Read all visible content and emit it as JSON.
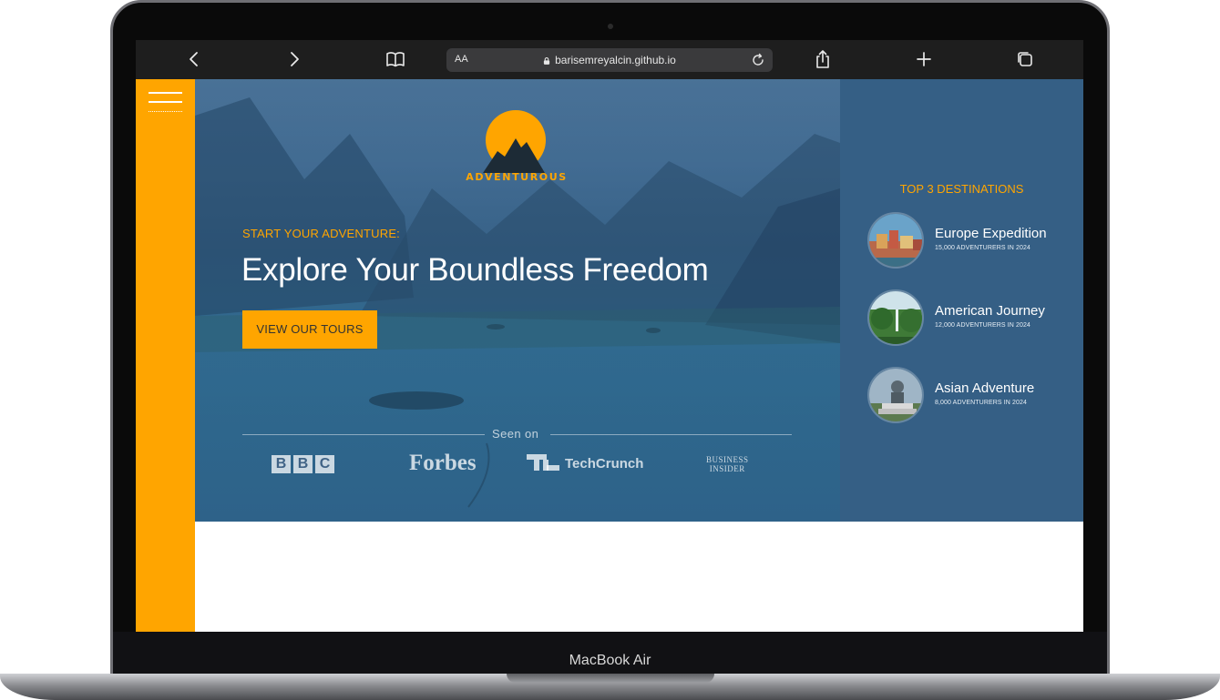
{
  "device": {
    "model_label": "MacBook Air"
  },
  "browser": {
    "address": {
      "text_size_label": "AA",
      "url": "barisemreyalcin.github.io"
    },
    "icons": [
      "back-icon",
      "forward-icon",
      "bookmarks-icon",
      "lock-icon",
      "reload-icon",
      "share-icon",
      "new-tab-icon",
      "tabs-icon"
    ]
  },
  "site": {
    "brand": "ADVENTUROUS",
    "hero": {
      "kicker": "START YOUR ADVENTURE:",
      "headline": "Explore Your Boundless Freedom",
      "cta_label": "VIEW OUR TOURS",
      "seen_on_label": "Seen on"
    },
    "press": {
      "bbc": [
        "B",
        "B",
        "C"
      ],
      "forbes": "Forbes",
      "techcrunch": "TechCrunch",
      "business_line1": "BUSINESS",
      "business_line2": "INSIDER"
    },
    "destinations": {
      "title": "TOP 3 DESTINATIONS",
      "items": [
        {
          "name": "Europe Expedition",
          "stat": "15,000 ADVENTURERS IN 2024"
        },
        {
          "name": "American Journey",
          "stat": "12,000 ADVENTURERS IN 2024"
        },
        {
          "name": "Asian Adventure",
          "stat": "8,000 ADVENTURERS IN 2024"
        }
      ]
    }
  },
  "colors": {
    "accent": "#ffa500",
    "panel": "#355f85",
    "hero_overlay": "#305d87",
    "toolbar": "#1e1e1e"
  }
}
